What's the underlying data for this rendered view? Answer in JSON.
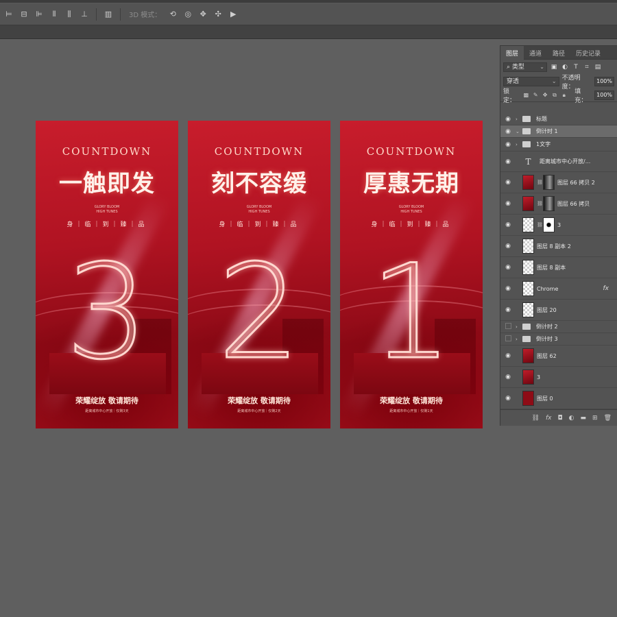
{
  "options_bar": {
    "mode_3d_label": "3D 模式："
  },
  "posters": [
    {
      "countdown": "COUNTDOWN",
      "headline": "一触即发",
      "glory_line1": "GLORY BLOOM",
      "glory_line2": "HIGH TUNES",
      "slogan": "身｜临｜到｜臻｜品",
      "digit": "3",
      "bottom_title": "荣耀绽放 敬请期待",
      "bottom_sub": "距离城市中心开放｜仅剩3天"
    },
    {
      "countdown": "COUNTDOWN",
      "headline": "刻不容缓",
      "glory_line1": "GLORY BLOOM",
      "glory_line2": "HIGH TUNES",
      "slogan": "身｜临｜到｜臻｜品",
      "digit": "2",
      "bottom_title": "荣耀绽放 敬请期待",
      "bottom_sub": "距离城市中心开放｜仅剩2天"
    },
    {
      "countdown": "COUNTDOWN",
      "headline": "厚惠无期",
      "glory_line1": "GLORY BLOOM",
      "glory_line2": "HIGH TUNES",
      "slogan": "身｜临｜到｜臻｜品",
      "digit": "1",
      "bottom_title": "荣耀绽放 敬请期待",
      "bottom_sub": "距离城市中心开放｜仅剩1天"
    }
  ],
  "layers_panel": {
    "tabs": [
      "图层",
      "通道",
      "路径",
      "历史记录"
    ],
    "filter_kind": "类型",
    "blend_mode": "穿透",
    "opacity_label": "不透明度：",
    "opacity_value": "100%",
    "lock_label": "锁定：",
    "fill_label": "填充：",
    "fill_value": "100%",
    "layers": [
      {
        "name": "标题"
      },
      {
        "name": "倒计时 1"
      },
      {
        "name": "1文字"
      },
      {
        "name": "距离城市中心开放/..."
      },
      {
        "name": "图层 66 拷贝 2"
      },
      {
        "name": "图层 66 拷贝"
      },
      {
        "name": "3"
      },
      {
        "name": "图层 8 副本 2"
      },
      {
        "name": "图层 8 副本"
      },
      {
        "name": "Chrome"
      },
      {
        "name": "图层 20"
      },
      {
        "name": "倒计时 2"
      },
      {
        "name": "倒计时 3"
      },
      {
        "name": "图层 62"
      },
      {
        "name": "3"
      },
      {
        "name": "图层 0"
      }
    ]
  }
}
